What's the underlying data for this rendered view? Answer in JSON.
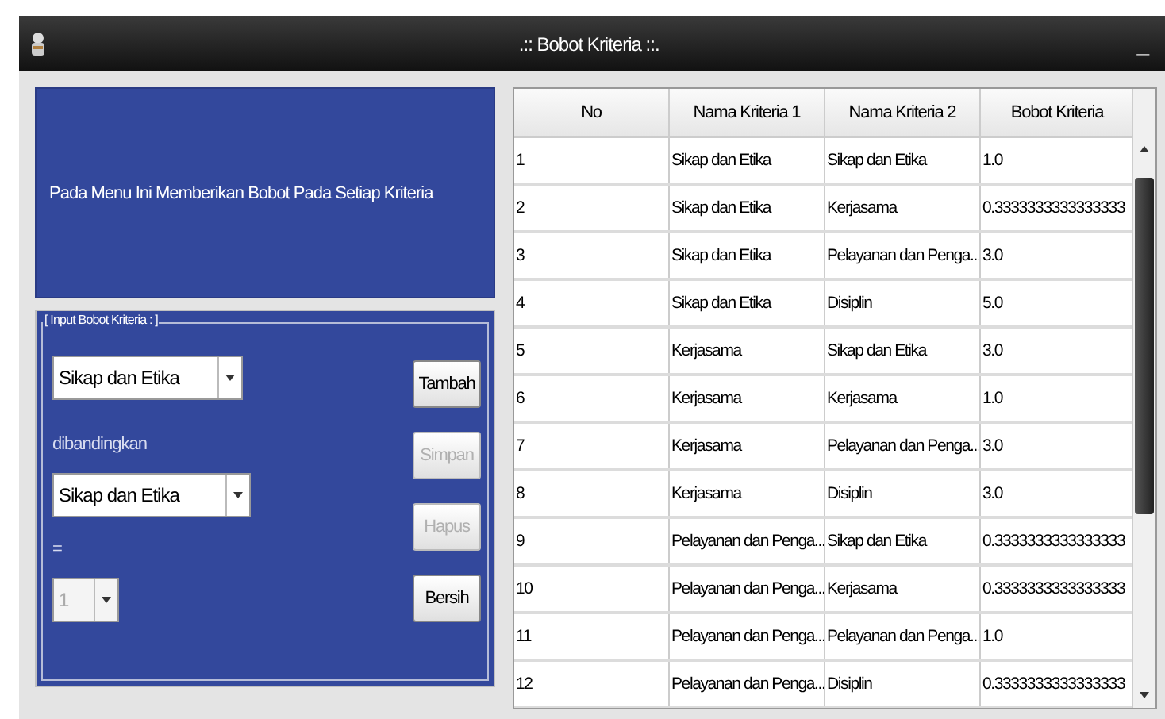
{
  "window": {
    "title": ".:: Bobot Kriteria ::.",
    "minimize": "_"
  },
  "info_panel": {
    "text": "Pada Menu Ini Memberikan Bobot Pada Setiap Kriteria"
  },
  "input_group": {
    "title": "[ Input Bobot Kriteria : ]",
    "criteria_1": {
      "value": "Sikap dan Etika",
      "disabled": false
    },
    "compare_label": "dibandingkan",
    "criteria_2": {
      "value": "Sikap dan Etika",
      "disabled": false
    },
    "equals_label": "=",
    "weight": {
      "value": "1",
      "disabled": true
    },
    "buttons": [
      {
        "label": "Tambah",
        "disabled": false
      },
      {
        "label": "Simpan",
        "disabled": true
      },
      {
        "label": "Hapus",
        "disabled": true
      },
      {
        "label": "Bersih",
        "disabled": false
      }
    ]
  },
  "table": {
    "columns": [
      "No",
      "Nama Kriteria 1",
      "Nama Kriteria 2",
      "Bobot Kriteria"
    ],
    "rows": [
      [
        "1",
        "Sikap dan Etika",
        "Sikap dan Etika",
        "1.0"
      ],
      [
        "2",
        "Sikap dan Etika",
        "Kerjasama",
        "0.3333333333333333"
      ],
      [
        "3",
        "Sikap dan Etika",
        "Pelayanan dan Penga...",
        "3.0"
      ],
      [
        "4",
        "Sikap dan Etika",
        "Disiplin",
        "5.0"
      ],
      [
        "5",
        "Kerjasama",
        "Sikap dan Etika",
        "3.0"
      ],
      [
        "6",
        "Kerjasama",
        "Kerjasama",
        "1.0"
      ],
      [
        "7",
        "Kerjasama",
        "Pelayanan dan Penga...",
        "3.0"
      ],
      [
        "8",
        "Kerjasama",
        "Disiplin",
        "3.0"
      ],
      [
        "9",
        "Pelayanan dan Penga...",
        "Sikap dan Etika",
        "0.3333333333333333"
      ],
      [
        "10",
        "Pelayanan dan Penga...",
        "Kerjasama",
        "0.3333333333333333"
      ],
      [
        "11",
        "Pelayanan dan Penga...",
        "Pelayanan dan Penga...",
        "1.0"
      ],
      [
        "12",
        "Pelayanan dan Penga...",
        "Disiplin",
        "0.3333333333333333"
      ]
    ]
  }
}
